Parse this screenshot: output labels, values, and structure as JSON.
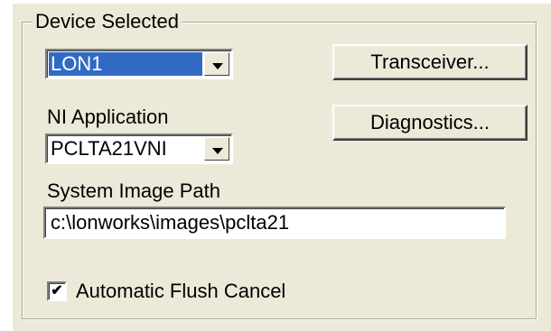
{
  "group": {
    "title": "Device Selected"
  },
  "device_combo": {
    "value": "LON1"
  },
  "buttons": {
    "transceiver": "Transceiver...",
    "diagnostics": "Diagnostics..."
  },
  "ni_application": {
    "label": "NI Application",
    "value": "PCLTA21VNI"
  },
  "system_image_path": {
    "label": "System Image Path",
    "value": "c:\\lonworks\\images\\pclta21"
  },
  "automatic_flush_cancel": {
    "label": "Automatic Flush Cancel",
    "checked": true,
    "mark": "✔"
  }
}
